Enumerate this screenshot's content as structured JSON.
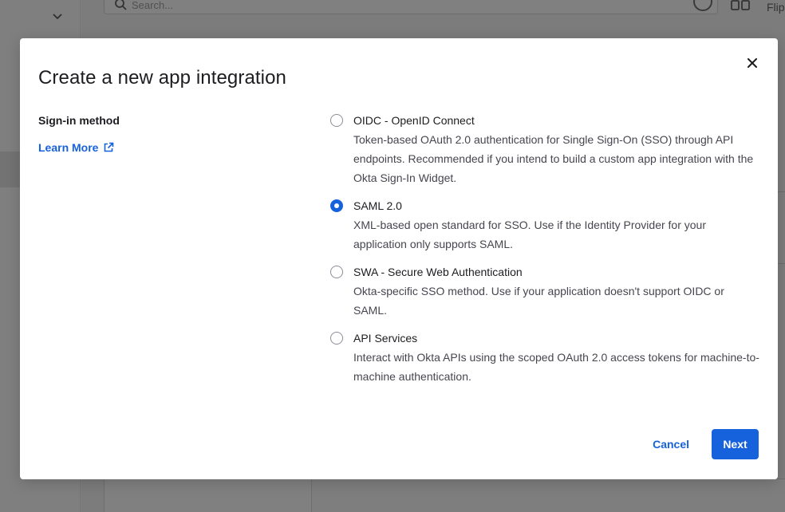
{
  "background": {
    "search_placeholder": "Search...",
    "header_partial_text": "Flip",
    "icons": [
      "chevron-down-icon",
      "search-icon",
      "help-icon",
      "grid-icon"
    ]
  },
  "modal": {
    "title": "Create a new app integration",
    "close_icon": "close-icon",
    "sign_in_label": "Sign-in method",
    "learn_more_label": "Learn More",
    "learn_more_icon": "external-link-icon",
    "options": [
      {
        "label": "OIDC - OpenID Connect",
        "description": "Token-based OAuth 2.0 authentication for Single Sign-On (SSO) through API endpoints. Recommended if you intend to build a custom app integration with the Okta Sign-In Widget.",
        "selected": false
      },
      {
        "label": "SAML 2.0",
        "description": "XML-based open standard for SSO. Use if the Identity Provider for your application only supports SAML.",
        "selected": true
      },
      {
        "label": "SWA - Secure Web Authentication",
        "description": "Okta-specific SSO method. Use if your application doesn't support OIDC or SAML.",
        "selected": false
      },
      {
        "label": "API Services",
        "description": "Interact with Okta APIs using the scoped OAuth 2.0 access tokens for machine-to-machine authentication.",
        "selected": false
      }
    ],
    "cancel_label": "Cancel",
    "next_label": "Next"
  },
  "colors": {
    "accent": "#1662dd",
    "overlay": "#7f7f7f",
    "text": "#1d1d21",
    "muted_text": "#46464f"
  }
}
